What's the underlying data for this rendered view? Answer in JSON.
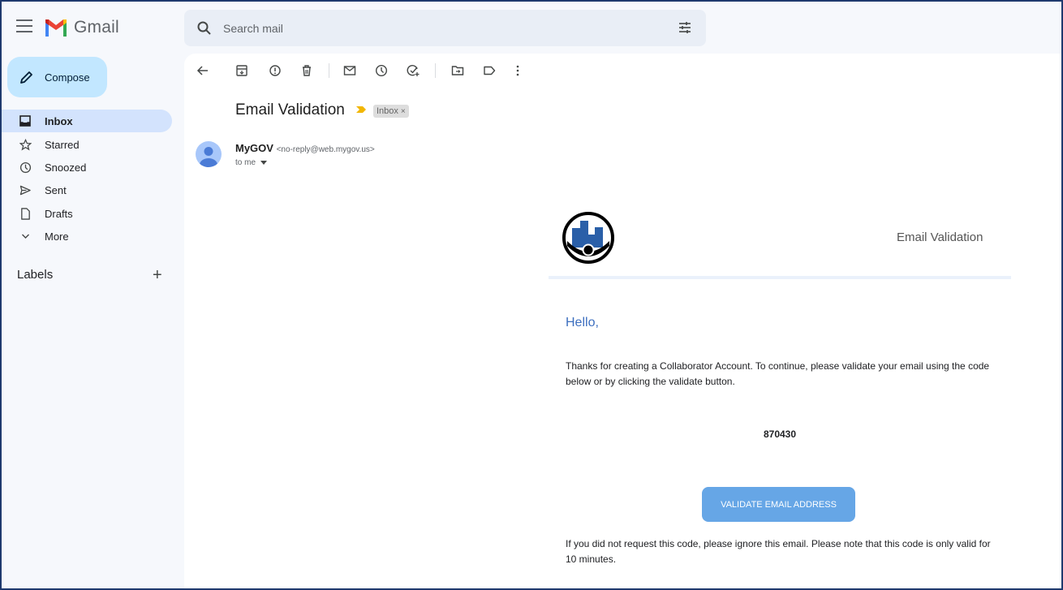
{
  "app": {
    "name": "Gmail"
  },
  "search": {
    "placeholder": "Search mail"
  },
  "compose": {
    "label": "Compose"
  },
  "nav": {
    "items": [
      {
        "label": "Inbox",
        "icon": "inbox-icon",
        "active": true
      },
      {
        "label": "Starred",
        "icon": "star-icon"
      },
      {
        "label": "Snoozed",
        "icon": "clock-icon"
      },
      {
        "label": "Sent",
        "icon": "send-icon"
      },
      {
        "label": "Drafts",
        "icon": "draft-icon"
      },
      {
        "label": "More",
        "icon": "chevron-down-icon"
      }
    ]
  },
  "labels": {
    "heading": "Labels",
    "add": "+"
  },
  "email": {
    "subject": "Email Validation",
    "label_chip": "Inbox",
    "label_chip_close": "×",
    "sender_name": "MyGOV",
    "sender_email": "<no-reply@web.mygov.us>",
    "to": "to me",
    "body": {
      "header_title": "Email Validation",
      "greeting": "Hello,",
      "intro": "Thanks for creating a Collaborator Account. To continue, please validate your email using the code below or by clicking the validate button.",
      "code": "870430",
      "button_label": "VALIDATE EMAIL ADDRESS",
      "footer": "If you did not request this code, please ignore this email. Please note that this code is only valid for 10 minutes."
    }
  },
  "colors": {
    "accent": "#c2e7ff",
    "nav_active": "#d3e3fd",
    "greeting": "#3d6fbf",
    "button": "#66a6e6",
    "gmail_red": "#ea4335"
  }
}
